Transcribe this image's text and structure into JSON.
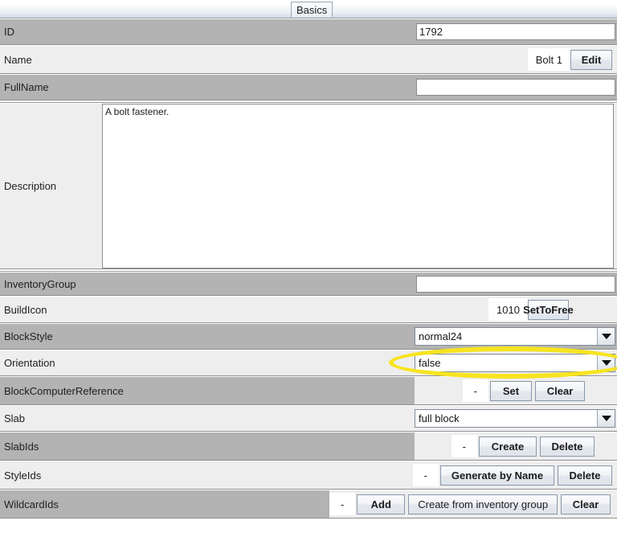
{
  "window": {
    "tab_label": "Basics"
  },
  "colors": {
    "row_dark": "#b3b3b3",
    "row_light": "#eeeeee",
    "highlight": "#f7e420",
    "button_border": "#8897ab"
  },
  "rows": {
    "id": {
      "label": "ID",
      "value": "1792"
    },
    "name": {
      "label": "Name",
      "value": "Bolt 1",
      "edit_button": "Edit"
    },
    "fullname": {
      "label": "FullName",
      "value": "",
      "placeholder": ""
    },
    "description": {
      "label": "Description",
      "value": "A bolt fastener."
    },
    "inventorygroup": {
      "label": "InventoryGroup",
      "value": "",
      "placeholder": ""
    },
    "buildicon": {
      "label": "BuildIcon",
      "value": "1010",
      "button": "SetToFree"
    },
    "blockstyle": {
      "label": "BlockStyle",
      "value": "normal24",
      "highlighted": true
    },
    "orientation": {
      "label": "Orientation",
      "value": "false"
    },
    "blockcomputerreference": {
      "label": "BlockComputerReference",
      "value": "-",
      "set_button": "Set",
      "clear_button": "Clear"
    },
    "slab": {
      "label": "Slab",
      "value": "full block"
    },
    "slabids": {
      "label": "SlabIds",
      "value": "-",
      "create_button": "Create",
      "delete_button": "Delete"
    },
    "styleids": {
      "label": "StyleIds",
      "value": "-",
      "generate_button": "Generate by Name",
      "delete_button": "Delete"
    },
    "wildcardids": {
      "label": "WildcardIds",
      "value": "-",
      "add_button": "Add",
      "create_from_group_button": "Create from inventory group",
      "clear_button": "Clear"
    }
  }
}
